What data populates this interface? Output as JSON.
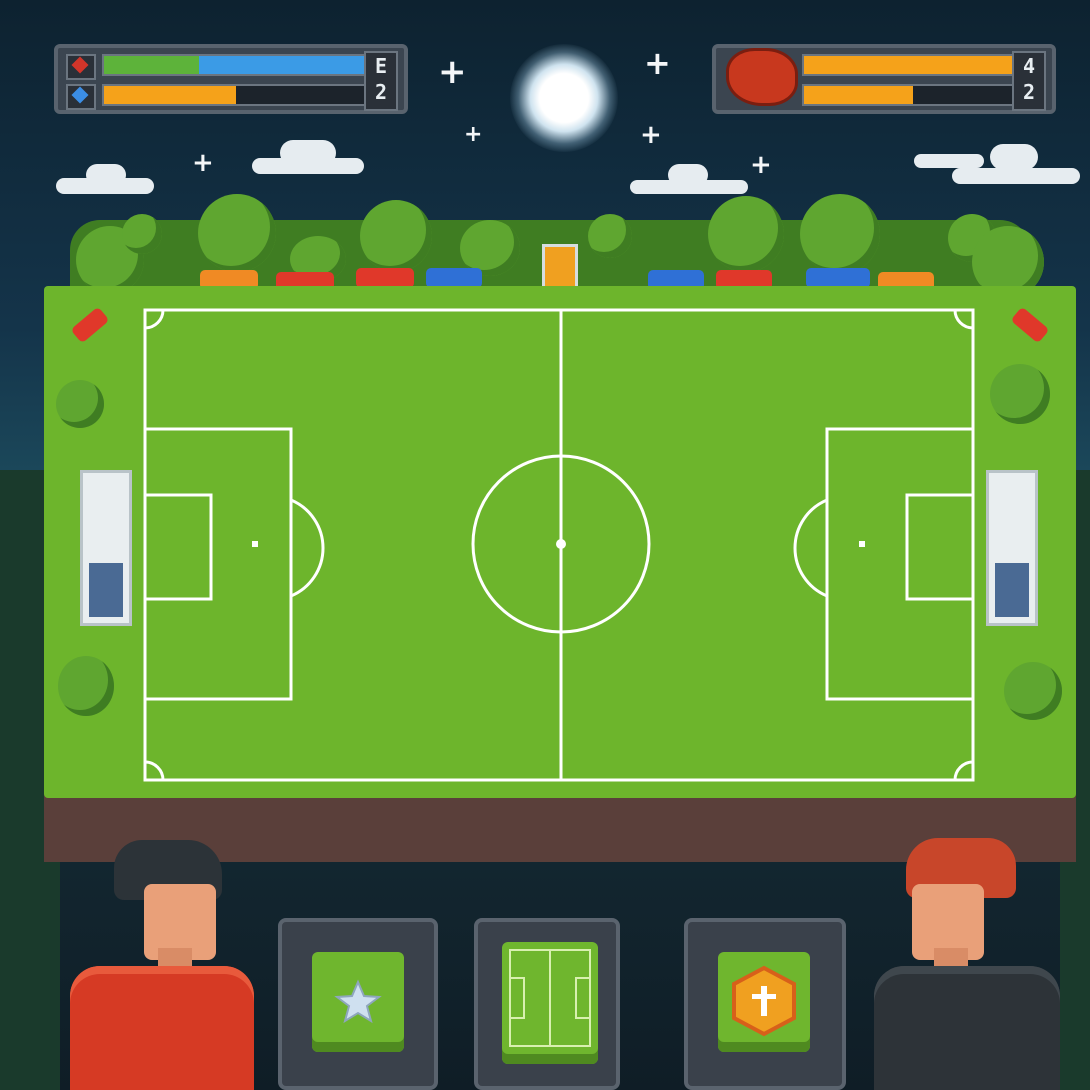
{
  "hud": {
    "left": {
      "score_top": "E",
      "score_bottom": "2",
      "icon_top": "red-diamond-icon",
      "icon_bottom": "blue-diamond-icon",
      "power_fill": 1.0,
      "stamina_fill": 0.5
    },
    "right": {
      "score_top": "4",
      "score_bottom": "2",
      "icon": "red-ball-icon",
      "power_fill": 1.0,
      "stamina_fill": 0.5
    }
  },
  "sky": {
    "moon": true,
    "sparkle_count": 6
  },
  "field": {
    "type": "soccer-pitch",
    "halves": 2
  },
  "players": {
    "left_color": "#d63a24",
    "right_color": "#2d3338"
  },
  "actions": [
    {
      "icon": "star-icon"
    },
    {
      "icon": "mini-pitch-icon"
    },
    {
      "icon": "hex-badge-icon"
    }
  ],
  "colors": {
    "grass": "#6db52c",
    "bar_blue": "#3b9be6",
    "bar_orange": "#f5a21a",
    "bar_green": "#5db33a"
  }
}
